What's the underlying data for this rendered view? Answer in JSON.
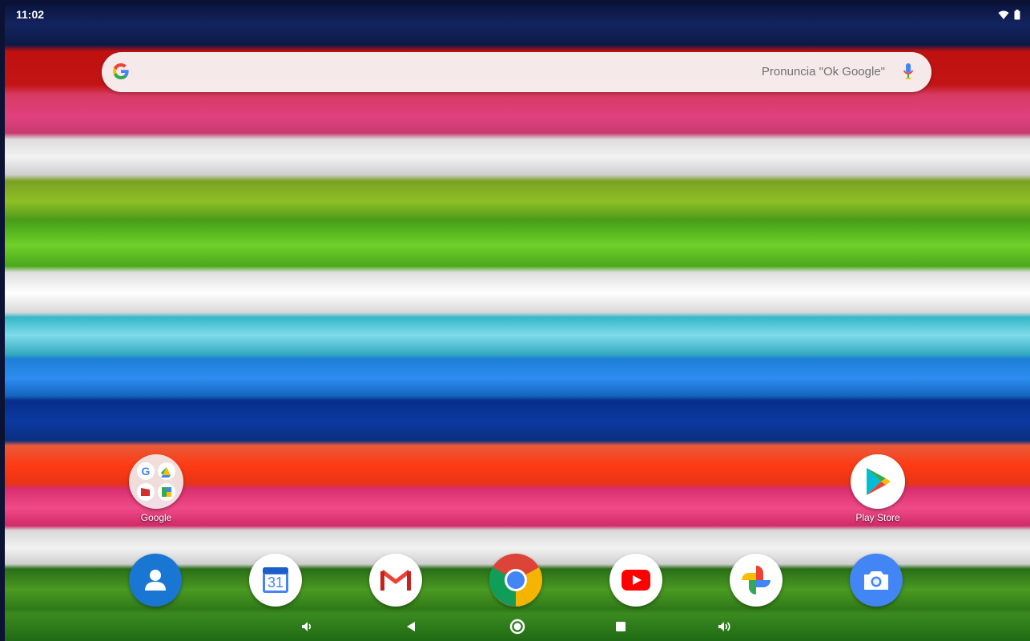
{
  "status_bar": {
    "time": "11:02",
    "icons": [
      "wifi-icon",
      "battery-icon"
    ]
  },
  "search": {
    "hint": "Pronuncia \"Ok Google\""
  },
  "home_apps": [
    {
      "label": "Google",
      "icon": "google-folder-icon"
    },
    {
      "label": "Play Store",
      "icon": "play-store-icon"
    }
  ],
  "dock": {
    "calendar_day": "31",
    "apps": [
      "contacts-icon",
      "calendar-icon",
      "gmail-icon",
      "chrome-icon",
      "youtube-icon",
      "photos-icon",
      "camera-icon"
    ]
  },
  "nav_bar": {
    "buttons": [
      "volume-down-icon",
      "back-icon",
      "home-icon",
      "recents-icon",
      "volume-up-icon"
    ]
  },
  "colors": {
    "google_blue": "#4285F4",
    "google_red": "#EA4335",
    "google_yellow": "#FBBC05",
    "google_green": "#34A853"
  }
}
